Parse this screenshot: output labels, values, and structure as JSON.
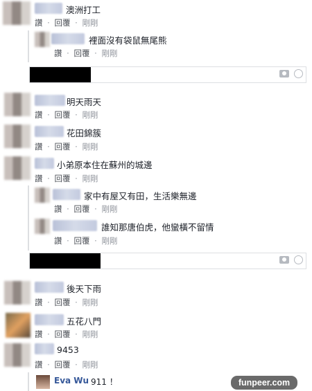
{
  "actions": {
    "read": "讚",
    "reply": "回覆",
    "sep": "·",
    "time": "剛剛"
  },
  "comments": [
    {
      "text": "澳洲打工"
    },
    {
      "text": "裡面沒有袋鼠無尾熊"
    },
    {
      "text": "明天雨天"
    },
    {
      "text": "花田錦簇"
    },
    {
      "text": "小弟原本住在蘇州的城邊"
    },
    {
      "text": "家中有屋又有田，生活樂無邊"
    },
    {
      "text": "誰知那唐伯虎，他蠻橫不留情"
    },
    {
      "text": "後天下雨"
    },
    {
      "text": "五花八門"
    },
    {
      "text": "9453"
    }
  ],
  "reply_last": {
    "name": "Eva Wu",
    "text": "911 ！"
  },
  "watermark": "funpeer.com"
}
